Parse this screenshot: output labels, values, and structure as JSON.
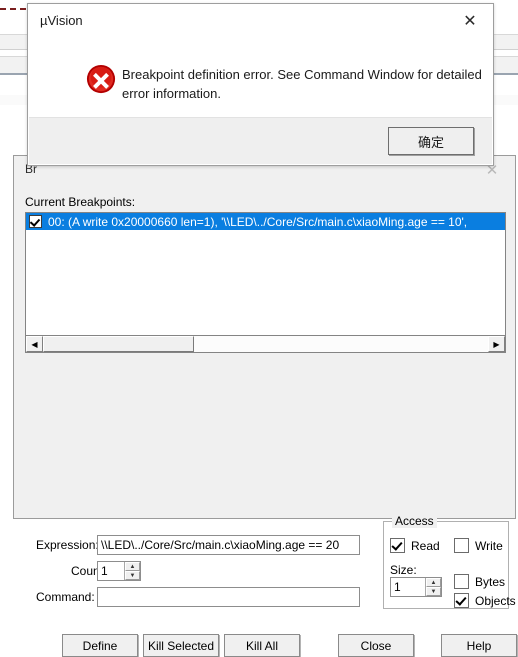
{
  "background": {
    "marker_name": "red-dashed-rule"
  },
  "breakpoints_dialog": {
    "title": "Br",
    "close_icon": "✕",
    "current_breakpoints_label": "Current Breakpoints:",
    "breakpoints": [
      {
        "checked": true,
        "text": "00: (A write 0x20000660 len=1),  '\\\\LED\\../Core/Src/main.c\\xiaoMing.age == 10',"
      }
    ],
    "scrollbar": {
      "left_arrow": "◀",
      "right_arrow": "▶"
    },
    "expression_label": "Expression:",
    "expression_value": "\\\\LED\\../Core/Src/main.c\\xiaoMing.age == 20",
    "count_label": "Count:",
    "count_value": "1",
    "command_label": "Command:",
    "command_value": "",
    "command_placeholder": "",
    "access": {
      "legend": "Access",
      "read_label": "Read",
      "read_checked": true,
      "write_label": "Write",
      "write_checked": false,
      "size_label": "Size:",
      "size_value": "1",
      "bytes_label": "Bytes",
      "bytes_checked": false,
      "objects_label": "Objects",
      "objects_checked": true
    },
    "buttons": {
      "define": "Define",
      "kill_selected": "Kill Selected",
      "kill_all": "Kill All",
      "close": "Close",
      "help": "Help"
    },
    "spinner": {
      "up": "▲",
      "down": "▼"
    }
  },
  "modal": {
    "title": "µVision",
    "close_icon": "✕",
    "icon": "error-icon",
    "message": "Breakpoint definition error. See Command Window for detailed error information.",
    "ok_label": "确定",
    "colors": {
      "error_red": "#cf1a1a",
      "selection_blue": "#0a7ee0"
    }
  }
}
